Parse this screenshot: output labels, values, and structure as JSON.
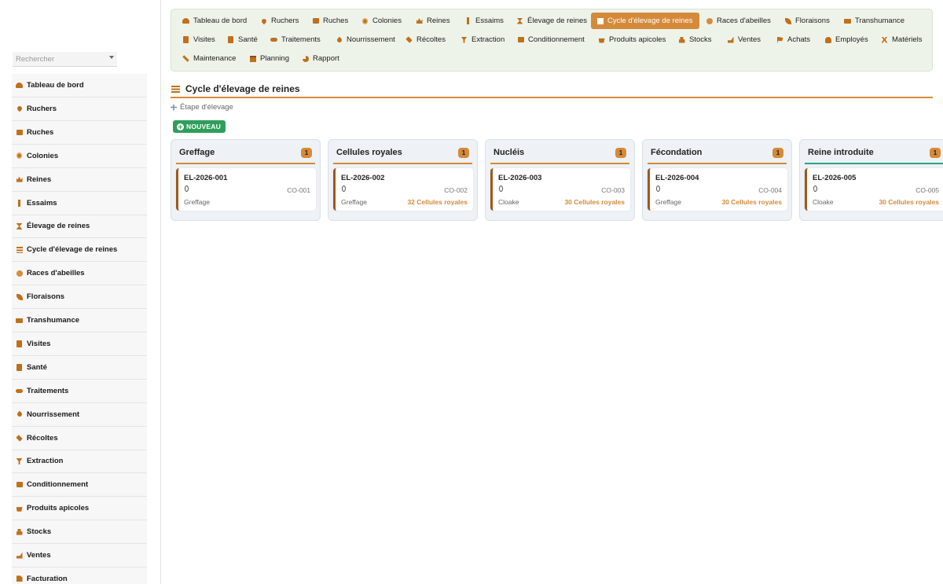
{
  "search": {
    "placeholder": "Rechercher"
  },
  "sidebar": {
    "items": [
      {
        "label": "Tableau de bord",
        "icon": "dashboard-icon"
      },
      {
        "label": "Ruchers",
        "icon": "map-pin-icon"
      },
      {
        "label": "Ruches",
        "icon": "hive-box-icon"
      },
      {
        "label": "Colonies",
        "icon": "bee-icon"
      },
      {
        "label": "Reines",
        "icon": "crown-icon"
      },
      {
        "label": "Essaims",
        "icon": "branch-icon"
      },
      {
        "label": "Élevage de reines",
        "icon": "hourglass-icon"
      },
      {
        "label": "Cycle d'élevage de reines",
        "icon": "list-icon"
      },
      {
        "label": "Races d'abeilles",
        "icon": "disc-icon"
      },
      {
        "label": "Floraisons",
        "icon": "leaf-icon"
      },
      {
        "label": "Transhumance",
        "icon": "truck-icon"
      },
      {
        "label": "Visites",
        "icon": "clipboard-icon"
      },
      {
        "label": "Santé",
        "icon": "medical-icon"
      },
      {
        "label": "Traitements",
        "icon": "pills-icon"
      },
      {
        "label": "Nourrissement",
        "icon": "drop-icon"
      },
      {
        "label": "Récoltes",
        "icon": "spray-icon"
      },
      {
        "label": "Extraction",
        "icon": "filter-icon"
      },
      {
        "label": "Conditionnement",
        "icon": "box-icon"
      },
      {
        "label": "Produits apicoles",
        "icon": "basket-icon"
      },
      {
        "label": "Stocks",
        "icon": "cubes-icon"
      },
      {
        "label": "Ventes",
        "icon": "hand-icon"
      },
      {
        "label": "Facturation",
        "icon": "invoice-icon"
      }
    ]
  },
  "topnav": {
    "row1": [
      {
        "label": "Tableau de bord",
        "icon": "dashboard-icon"
      },
      {
        "label": "Ruchers",
        "icon": "map-pin-icon"
      },
      {
        "label": "Ruches",
        "icon": "hive-box-icon"
      },
      {
        "label": "Colonies",
        "icon": "bee-icon"
      },
      {
        "label": "Reines",
        "icon": "crown-icon"
      },
      {
        "label": "Essaims",
        "icon": "branch-icon"
      },
      {
        "label": "Élevage de reines",
        "icon": "hourglass-icon"
      },
      {
        "label": "Cycle d'élevage de reines",
        "icon": "list-icon",
        "active": true
      },
      {
        "label": "Races d'abeilles",
        "icon": "disc-icon"
      },
      {
        "label": "Floraisons",
        "icon": "leaf-icon"
      },
      {
        "label": "Transhumance",
        "icon": "truck-icon"
      }
    ],
    "row2": [
      {
        "label": "Visites",
        "icon": "clipboard-icon"
      },
      {
        "label": "Santé",
        "icon": "medical-icon"
      },
      {
        "label": "Traitements",
        "icon": "pills-icon"
      },
      {
        "label": "Nourrissement",
        "icon": "drop-icon"
      },
      {
        "label": "Récoltes",
        "icon": "spray-icon"
      },
      {
        "label": "Extraction",
        "icon": "filter-icon"
      },
      {
        "label": "Conditionnement",
        "icon": "box-icon"
      },
      {
        "label": "Produits apicoles",
        "icon": "basket-icon"
      },
      {
        "label": "Stocks",
        "icon": "cubes-icon"
      },
      {
        "label": "Ventes",
        "icon": "hand-icon"
      },
      {
        "label": "Achats",
        "icon": "cart-icon"
      },
      {
        "label": "Employés",
        "icon": "user-icon"
      },
      {
        "label": "Matériels",
        "icon": "tools-icon"
      }
    ],
    "row3": [
      {
        "label": "Maintenance",
        "icon": "wrench-icon"
      },
      {
        "label": "Planning",
        "icon": "calendar-icon"
      },
      {
        "label": "Rapport",
        "icon": "pie-chart-icon"
      }
    ]
  },
  "page": {
    "title": "Cycle d'élevage de reines",
    "sub_link": "Étape d'élevage",
    "new_button": "NOUVEAU"
  },
  "colors": {
    "accent": "#d58a3a",
    "nav_bg": "#eef3ea",
    "success": "#2f9e5a",
    "teal": "#2aa38a"
  },
  "board": {
    "columns": [
      {
        "title": "Greffage",
        "count": "1",
        "card": {
          "id": "EL-2026-001",
          "colony": "CO-001",
          "stage": "Greffage",
          "cells": ""
        }
      },
      {
        "title": "Cellules royales",
        "count": "1",
        "card": {
          "id": "EL-2026-002",
          "colony": "CO-002",
          "stage": "Greffage",
          "cells": "32 Cellules royales"
        }
      },
      {
        "title": "Nucléis",
        "count": "1",
        "card": {
          "id": "EL-2026-003",
          "colony": "CO-003",
          "stage": "Cloake",
          "cells": "30 Cellules royales"
        }
      },
      {
        "title": "Fécondation",
        "count": "1",
        "card": {
          "id": "EL-2026-004",
          "colony": "CO-004",
          "stage": "Greffage",
          "cells": "30 Cellules royales"
        }
      },
      {
        "title": "Reine introduite",
        "count": "1",
        "card": {
          "id": "EL-2026-005",
          "colony": "CO-005",
          "stage": "Cloake",
          "cells": "30 Cellules royales"
        }
      }
    ]
  }
}
